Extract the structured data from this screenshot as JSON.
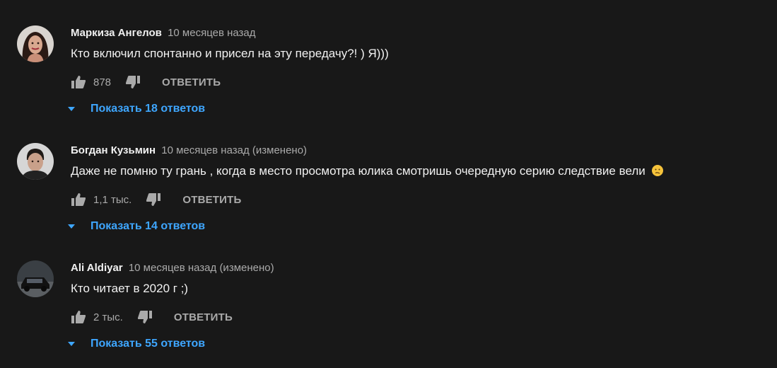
{
  "comments": [
    {
      "author": "Маркиза Ангелов",
      "time": "10 месяцев назад",
      "text": "Кто включил спонтанно и присел на эту передачу?!  ) Я)))",
      "likes": "878",
      "reply_label": "ОТВЕТИТЬ",
      "replies_label": "Показать 18 ответов",
      "avatar_icon": "avatar-woman"
    },
    {
      "author": "Богдан Кузьмин",
      "time": "10 месяцев назад (изменено)",
      "text": "Даже не помню ту грань , когда в место просмотра юлика смотришь очередную серию следствие вели",
      "emoji": "confused-face-icon",
      "likes": "1,1 тыс.",
      "reply_label": "ОТВЕТИТЬ",
      "replies_label": "Показать 14 ответов",
      "avatar_icon": "avatar-man"
    },
    {
      "author": "Ali Aldiyar",
      "time": "10 месяцев назад (изменено)",
      "text": "Кто читает в 2020 г ;)",
      "likes": "2 тыс.",
      "reply_label": "ОТВЕТИТЬ",
      "replies_label": "Показать 55 ответов",
      "avatar_icon": "avatar-car"
    }
  ],
  "colors": {
    "background": "#181818",
    "text": "#f1f1f1",
    "secondary": "#aaaaaa",
    "link": "#3ea6ff"
  }
}
